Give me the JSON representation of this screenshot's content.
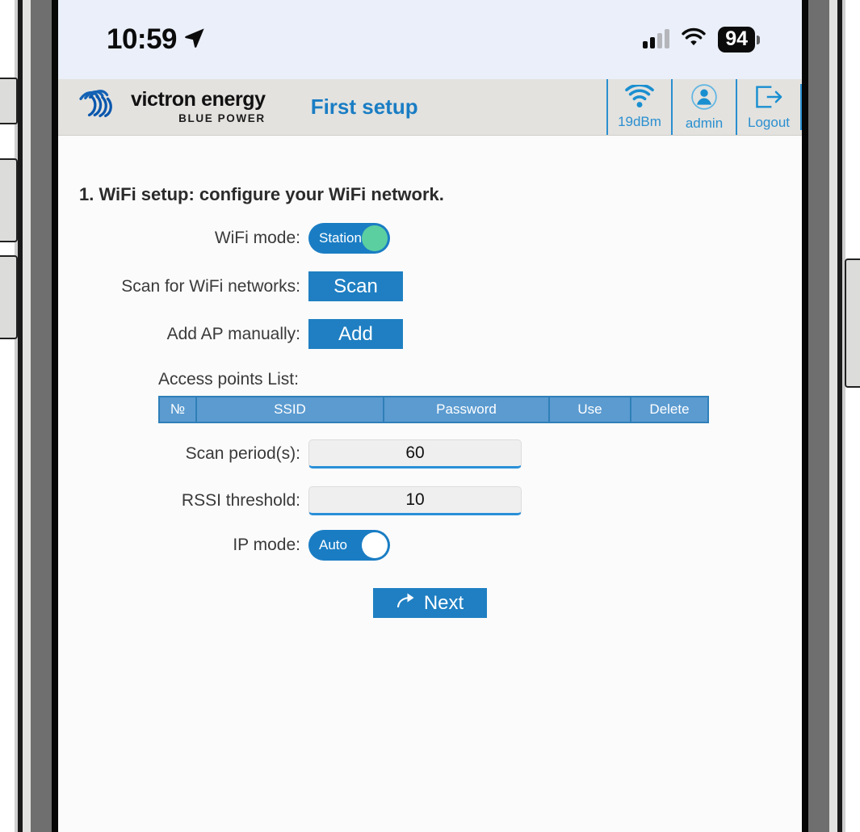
{
  "status_bar": {
    "time": "10:59",
    "location_icon": "location-arrow-icon",
    "cell_icon": "cellular-signal-icon",
    "wifi_icon": "wifi-icon",
    "battery_level": "94"
  },
  "header": {
    "logo_name": "victron energy",
    "logo_sub": "BLUE POWER",
    "page_title": "First setup",
    "tools": [
      {
        "icon": "wifi-signal-icon",
        "label": "19dBm"
      },
      {
        "icon": "user-icon",
        "label": "admin"
      },
      {
        "icon": "logout-icon",
        "label": "Logout"
      }
    ]
  },
  "main": {
    "section_title": "1. WiFi setup: configure your WiFi network.",
    "wifi_mode": {
      "label": "WiFi mode:",
      "value": "Station"
    },
    "scan_networks": {
      "label": "Scan for WiFi networks:",
      "button": "Scan"
    },
    "add_ap": {
      "label": "Add AP manually:",
      "button": "Add"
    },
    "ap_list": {
      "label": "Access points List:",
      "columns": [
        "№",
        "SSID",
        "Password",
        "Use",
        "Delete"
      ],
      "rows": []
    },
    "scan_period": {
      "label": "Scan period(s):",
      "value": "60",
      "placeholder": "60"
    },
    "rssi_threshold": {
      "label": "RSSI threshold:",
      "value": "10",
      "placeholder": "10"
    },
    "ip_mode": {
      "label": "IP mode:",
      "value": "Auto"
    },
    "next_button": {
      "label": "Next",
      "icon": "curved-arrow-right-icon"
    }
  },
  "colors": {
    "accent_blue": "#1f7fc2",
    "title_blue": "#1a7dc4",
    "table_header_blue": "#5b9bd0",
    "toggle_knob_green": "#5ccfa0",
    "header_bg": "#e3e2df",
    "status_bar_bg": "#eaeff9"
  }
}
